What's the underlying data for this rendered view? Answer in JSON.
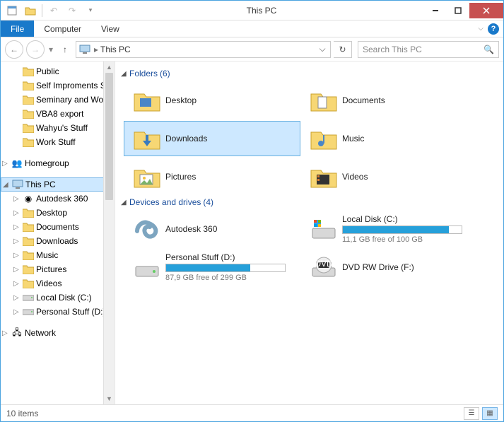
{
  "window": {
    "title": "This PC"
  },
  "ribbon": {
    "file": "File",
    "computer": "Computer",
    "view": "View"
  },
  "nav": {
    "location": "This PC",
    "search_placeholder": "Search This PC"
  },
  "sidebar": {
    "favorites": [
      "Public",
      "Self Improments S",
      "Seminary and Wo",
      "VBA8 export",
      "Wahyu's Stuff",
      "Work Stuff"
    ],
    "homegroup": "Homegroup",
    "this_pc": "This PC",
    "pc_children": [
      "Autodesk 360",
      "Desktop",
      "Documents",
      "Downloads",
      "Music",
      "Pictures",
      "Videos",
      "Local Disk (C:)",
      "Personal Stuff (D:)"
    ],
    "network": "Network"
  },
  "groups": {
    "folders": {
      "label": "Folders",
      "count": "(6)"
    },
    "drives": {
      "label": "Devices and drives",
      "count": "(4)"
    }
  },
  "folders": [
    {
      "name": "Desktop"
    },
    {
      "name": "Documents"
    },
    {
      "name": "Downloads"
    },
    {
      "name": "Music"
    },
    {
      "name": "Pictures"
    },
    {
      "name": "Videos"
    }
  ],
  "drives": [
    {
      "name": "Autodesk 360",
      "sub": "",
      "fill": null
    },
    {
      "name": "Local Disk (C:)",
      "sub": "11,1 GB free of 100 GB",
      "fill": 89
    },
    {
      "name": "Personal Stuff (D:)",
      "sub": "87,9 GB free of 299 GB",
      "fill": 71
    },
    {
      "name": "DVD RW Drive (F:)",
      "sub": "",
      "fill": null
    }
  ],
  "status": {
    "items": "10 items"
  }
}
